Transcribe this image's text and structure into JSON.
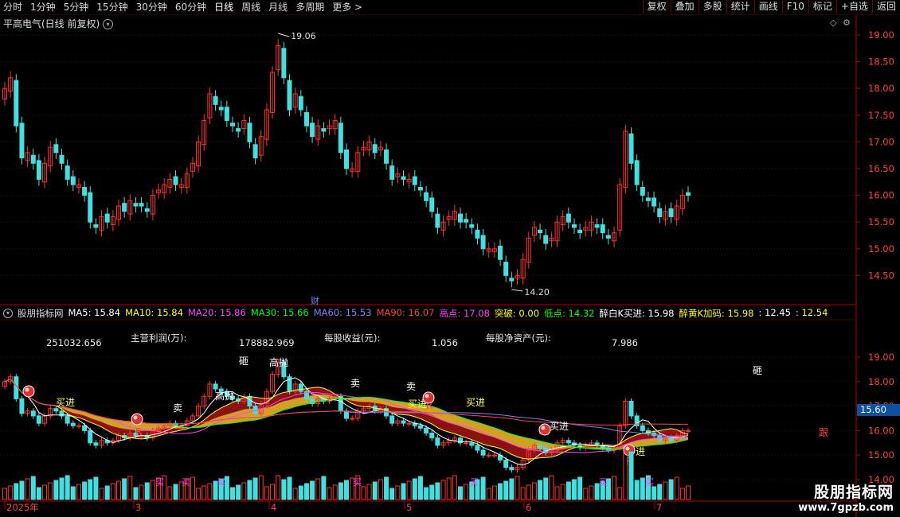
{
  "toolbar": {
    "periods": [
      "分时",
      "1分钟",
      "5分钟",
      "15分钟",
      "30分钟",
      "60分钟",
      "日线",
      "周线",
      "月线",
      "多周期",
      "更多 >"
    ],
    "active_period": "日线",
    "buttons": [
      "复权",
      "叠加",
      "多股",
      "统计",
      "画线",
      "F10",
      "标记",
      "+自选",
      "返回"
    ]
  },
  "main_panel": {
    "title": "平高电气(日线 前复权)",
    "high_marker": "19.06",
    "low_marker": "14.20",
    "event_label": "财",
    "y_ticks": [
      "19.00",
      "18.50",
      "18.00",
      "17.50",
      "17.00",
      "16.50",
      "16.00",
      "15.50",
      "15.00",
      "14.50"
    ]
  },
  "indicator_panel": {
    "name": "股朋指标网",
    "items": [
      {
        "label": "MA5: 15.84",
        "color": "#ffffff"
      },
      {
        "label": "MA10: 15.84",
        "color": "#ffff00"
      },
      {
        "label": "MA20: 15.86",
        "color": "#ff40ff"
      },
      {
        "label": "MA30: 15.66",
        "color": "#00ff00"
      },
      {
        "label": "MA60: 15.53",
        "color": "#8080ff"
      },
      {
        "label": "MA90: 16.07",
        "color": "#ff4040"
      },
      {
        "label": "高点: 17.08",
        "color": "#ff40ff"
      },
      {
        "label": "突破: 0.00",
        "color": "#ffff00"
      },
      {
        "label": "低点: 14.32",
        "color": "#00ff00"
      },
      {
        "label": "醉白K买进: 15.98",
        "color": "#ffffff"
      },
      {
        "label": "醉黄K加码: 15.98",
        "color": "#ffff00"
      },
      {
        "label": ": 12.45",
        "color": "#ffffff"
      },
      {
        "label": ": 12.54",
        "color": "#ffff00"
      }
    ],
    "y_ticks": [
      "19.00",
      "18.00",
      "17.00",
      "16.00",
      "15.00",
      "14.00"
    ],
    "price_tag": "15.60",
    "financials": {
      "v1": "251032.656",
      "main_profit_label": "主营利润(万):",
      "v2": "178882.969",
      "eps_label": "每股收益(元):",
      "eps": "1.056",
      "bvps_label": "每股净资产(元):",
      "bvps": "7.986"
    },
    "annotations": [
      "砸",
      "高抛",
      "高抛",
      "卖",
      "买进",
      "买进",
      "买进",
      "买进",
      "砸",
      "跟",
      "R",
      "R",
      "R",
      "R",
      "卖",
      "卖",
      "进"
    ],
    "volume_labels": [
      "买",
      "买",
      "买",
      "买",
      "买",
      "买",
      "买"
    ]
  },
  "time_axis": [
    "2025年",
    "3",
    "4",
    "5",
    "6",
    "7"
  ],
  "watermark": {
    "line1": "股朋指标网",
    "line2": "www.7gpzb.com"
  },
  "colors": {
    "up": "#ff3030",
    "down": "#40e0e0",
    "axis": "#ff4040",
    "grid": "#5a0000"
  }
}
